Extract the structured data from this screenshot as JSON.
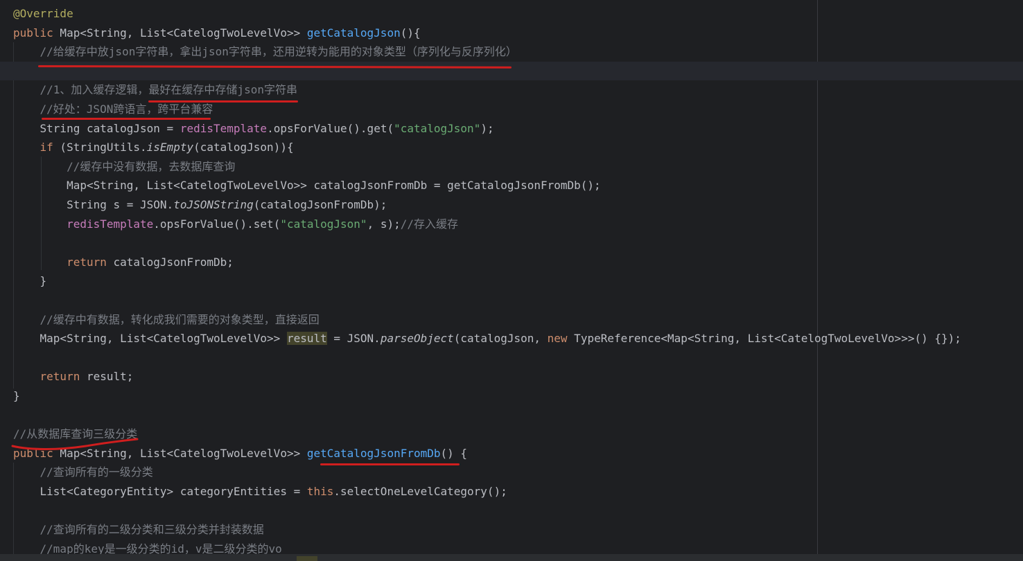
{
  "editor": {
    "theme_colors": {
      "background": "#1e1f22",
      "keyword": "#cf8e6d",
      "method": "#56a8f5",
      "field": "#c77dbb",
      "string": "#6aab73",
      "comment": "#7a7e85",
      "annotation": "#b3ae60",
      "text": "#bcbec4",
      "annotation_marker": "#d01e1e"
    },
    "lines": [
      {
        "segments": [
          {
            "t": "@Override",
            "k": "annotation"
          }
        ]
      },
      {
        "segments": [
          {
            "t": "public",
            "k": "keyword"
          },
          {
            "t": " Map<String, List<CatelogTwoLevelVo>> ",
            "k": "code"
          },
          {
            "t": "getCatalogJson",
            "k": "method-decl"
          },
          {
            "t": "(){",
            "k": "code"
          }
        ]
      },
      {
        "segments": [
          {
            "t": "    ",
            "k": "code"
          },
          {
            "t": "//给缓存中放json字符串，拿出json字符串，还用逆转为能用的对象类型（序列化与反序列化）",
            "k": "comment"
          }
        ]
      },
      {
        "current": true,
        "segments": [
          {
            "t": "",
            "k": "code"
          }
        ]
      },
      {
        "segments": [
          {
            "t": "    ",
            "k": "code"
          },
          {
            "t": "//1、加入缓存逻辑，最好在缓存中存储json字符串",
            "k": "comment"
          }
        ]
      },
      {
        "segments": [
          {
            "t": "    ",
            "k": "code"
          },
          {
            "t": "//好处：JSON跨语言，跨平台兼容",
            "k": "comment"
          }
        ]
      },
      {
        "segments": [
          {
            "t": "    String catalogJson = ",
            "k": "code"
          },
          {
            "t": "redisTemplate",
            "k": "field"
          },
          {
            "t": ".opsForValue().get(",
            "k": "code"
          },
          {
            "t": "\"catalogJson\"",
            "k": "string"
          },
          {
            "t": ");",
            "k": "code"
          }
        ]
      },
      {
        "segments": [
          {
            "t": "    ",
            "k": "code"
          },
          {
            "t": "if",
            "k": "keyword"
          },
          {
            "t": " (StringUtils.",
            "k": "code"
          },
          {
            "t": "isEmpty",
            "k": "italic"
          },
          {
            "t": "(catalogJson)){",
            "k": "code"
          }
        ]
      },
      {
        "segments": [
          {
            "t": "        ",
            "k": "code"
          },
          {
            "t": "//缓存中没有数据，去数据库查询",
            "k": "comment"
          }
        ]
      },
      {
        "segments": [
          {
            "t": "        Map<String, List<CatelogTwoLevelVo>> catalogJsonFromDb = getCatalogJsonFromDb();",
            "k": "code"
          }
        ]
      },
      {
        "segments": [
          {
            "t": "        String s = JSON.",
            "k": "code"
          },
          {
            "t": "toJSONString",
            "k": "italic"
          },
          {
            "t": "(catalogJsonFromDb);",
            "k": "code"
          }
        ]
      },
      {
        "segments": [
          {
            "t": "        ",
            "k": "code"
          },
          {
            "t": "redisTemplate",
            "k": "field"
          },
          {
            "t": ".opsForValue().set(",
            "k": "code"
          },
          {
            "t": "\"catalogJson\"",
            "k": "string"
          },
          {
            "t": ", s);",
            "k": "code"
          },
          {
            "t": "//存入缓存",
            "k": "comment"
          }
        ]
      },
      {
        "segments": [
          {
            "t": "",
            "k": "code"
          }
        ]
      },
      {
        "segments": [
          {
            "t": "        ",
            "k": "code"
          },
          {
            "t": "return",
            "k": "keyword"
          },
          {
            "t": " catalogJsonFromDb;",
            "k": "code"
          }
        ]
      },
      {
        "segments": [
          {
            "t": "    }",
            "k": "code"
          }
        ]
      },
      {
        "segments": [
          {
            "t": "",
            "k": "code"
          }
        ]
      },
      {
        "segments": [
          {
            "t": "    ",
            "k": "code"
          },
          {
            "t": "//缓存中有数据，转化成我们需要的对象类型，直接返回",
            "k": "comment"
          }
        ]
      },
      {
        "segments": [
          {
            "t": "    Map<String, List<CatelogTwoLevelVo>> ",
            "k": "code"
          },
          {
            "t": "result",
            "k": "highlight"
          },
          {
            "t": " = JSON.",
            "k": "code"
          },
          {
            "t": "parseObject",
            "k": "italic"
          },
          {
            "t": "(catalogJson, ",
            "k": "code"
          },
          {
            "t": "new",
            "k": "keyword"
          },
          {
            "t": " TypeReference<Map<String, List<CatelogTwoLevelVo>>>() {});",
            "k": "code"
          }
        ]
      },
      {
        "segments": [
          {
            "t": "",
            "k": "code"
          }
        ]
      },
      {
        "segments": [
          {
            "t": "    ",
            "k": "code"
          },
          {
            "t": "return",
            "k": "keyword"
          },
          {
            "t": " result;",
            "k": "code"
          }
        ]
      },
      {
        "segments": [
          {
            "t": "}",
            "k": "code"
          }
        ]
      },
      {
        "segments": [
          {
            "t": "",
            "k": "code"
          }
        ]
      },
      {
        "segments": [
          {
            "t": "//从数据库查询三级分类",
            "k": "comment"
          }
        ]
      },
      {
        "segments": [
          {
            "t": "public",
            "k": "keyword"
          },
          {
            "t": " Map<String, List<CatelogTwoLevelVo>> ",
            "k": "code"
          },
          {
            "t": "getCatalogJsonFromDb",
            "k": "method-decl"
          },
          {
            "t": "() {",
            "k": "code"
          }
        ]
      },
      {
        "segments": [
          {
            "t": "    ",
            "k": "code"
          },
          {
            "t": "//查询所有的一级分类",
            "k": "comment"
          }
        ]
      },
      {
        "segments": [
          {
            "t": "    List<CategoryEntity> categoryEntities = ",
            "k": "code"
          },
          {
            "t": "this",
            "k": "keyword"
          },
          {
            "t": ".selectOneLevelCategory();",
            "k": "code"
          }
        ]
      },
      {
        "segments": [
          {
            "t": "",
            "k": "code"
          }
        ]
      },
      {
        "segments": [
          {
            "t": "    ",
            "k": "code"
          },
          {
            "t": "//查询所有的二级分类和三级分类并封装数据",
            "k": "comment"
          }
        ]
      },
      {
        "segments": [
          {
            "t": "    ",
            "k": "code"
          },
          {
            "t": "//map的key是一级分类的id，v是二级分类的vo",
            "k": "comment"
          }
        ]
      }
    ]
  }
}
